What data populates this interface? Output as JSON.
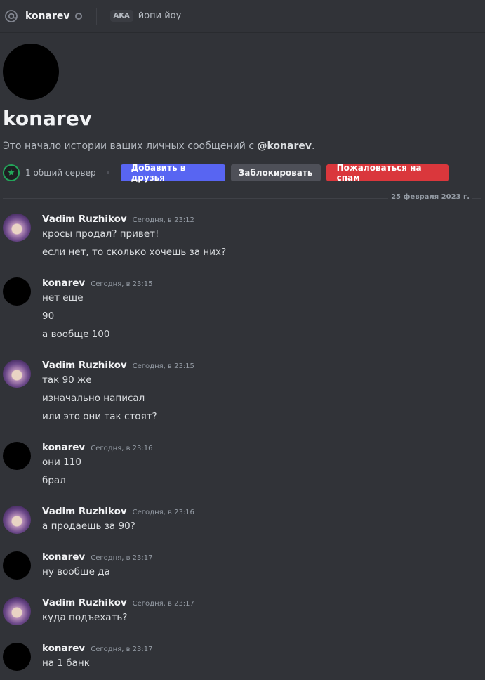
{
  "header": {
    "username": "konarev",
    "aka_badge": "AKA",
    "aka_name": "йопи йоу"
  },
  "welcome": {
    "title": "konarev",
    "subtitle_prefix": "Это начало истории ваших личных сообщений с ",
    "subtitle_mention": "@konarev",
    "subtitle_suffix": ".",
    "mutual_servers": "1 общий сервер",
    "add_friend_label": "Добавить в друзья",
    "block_label": "Заблокировать",
    "report_spam_label": "Пожаловаться на спам"
  },
  "date_divider": "25 февраля 2023 г.",
  "messages": [
    {
      "author": "Vadim Ruzhikov",
      "time": "Сегодня, в 23:12",
      "lines": [
        "кросы продал? привет!",
        "если нет, то сколько хочешь за них?"
      ]
    },
    {
      "author": "konarev",
      "time": "Сегодня, в 23:15",
      "lines": [
        "нет еще",
        "90",
        "а вообще 100"
      ]
    },
    {
      "author": "Vadim Ruzhikov",
      "time": "Сегодня, в 23:15",
      "lines": [
        "так 90 же",
        "изначально написал",
        "или это они так стоят?"
      ]
    },
    {
      "author": "konarev",
      "time": "Сегодня, в 23:16",
      "lines": [
        "они 110",
        "брал"
      ]
    },
    {
      "author": "Vadim Ruzhikov",
      "time": "Сегодня, в 23:16",
      "lines": [
        "а продаешь за 90?"
      ]
    },
    {
      "author": "konarev",
      "time": "Сегодня, в 23:17",
      "lines": [
        "ну вообще да"
      ]
    },
    {
      "author": "Vadim Ruzhikov",
      "time": "Сегодня, в 23:17",
      "lines": [
        "куда подъехать?"
      ]
    },
    {
      "author": "konarev",
      "time": "Сегодня, в 23:17",
      "lines": [
        "на 1 банк"
      ]
    }
  ],
  "colors": {
    "background": "#313338",
    "brand": "#5865f2",
    "danger": "#da373c",
    "online_green": "#23a55a"
  },
  "icons": {
    "channel": "at-sign-icon",
    "status": "offline-status-icon",
    "mutual_server": "server-icon"
  }
}
